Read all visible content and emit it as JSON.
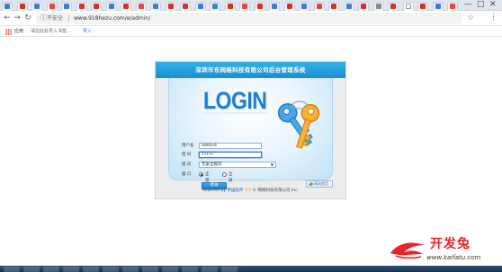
{
  "browser": {
    "tab_favicon_colors": [
      "#3b7dd8",
      "#d93025",
      "#3b7dd8",
      "#e8453c",
      "#3b7dd8",
      "#d93025",
      "#d93025",
      "#3b7dd8",
      "#d93025",
      "#e8453c",
      "#3b7dd8",
      "#d93025",
      "#d93025",
      "#3b7dd8",
      "#3b7dd8",
      "#d93025",
      "#e8453c",
      "#d93025",
      "#3b7dd8",
      "#d93025",
      "#3b7dd8",
      "#e8453c",
      "#d93025",
      "#3b7dd8",
      "#d93025",
      "#888888",
      "#d93025",
      "#ffffff",
      "#d93025",
      "#3b7dd8",
      "#e8453c"
    ],
    "window_controls": [
      "—",
      "□",
      "✕"
    ],
    "security_label": "不安全",
    "url": "www.918hezu.com/e/admin/",
    "bookmarks_bar": {
      "apps_label": "应用",
      "hint": "请在此处导入书签...",
      "link": "导入"
    }
  },
  "login": {
    "header_title": "深圳市东网络科技有限公司后台管理系统",
    "hero_text": "LOGIN",
    "fields": [
      {
        "label": "用户名",
        "value": "admin4"
      },
      {
        "label": "密 码",
        "value": "•••••"
      },
      {
        "label": "提 问",
        "value": "无安全提问"
      }
    ],
    "window_label": "窗 口",
    "window_options": [
      "正常",
      "全屏"
    ],
    "selected_window_option": "正常",
    "login_button": "登录",
    "home_button": "网站首页",
    "footer": {
      "prefix": "Powered by ",
      "brand": "帝国软件",
      "version": "7.5",
      "suffix": " © 网络科技有限公司 Inc."
    }
  },
  "watermark": {
    "cn": "开发兔",
    "en": "www.kaifatu.com"
  },
  "colors": {
    "header_blue": "#1a8fd2",
    "login_blue": "#1f7fcf",
    "watermark_red": "#e8232a"
  }
}
